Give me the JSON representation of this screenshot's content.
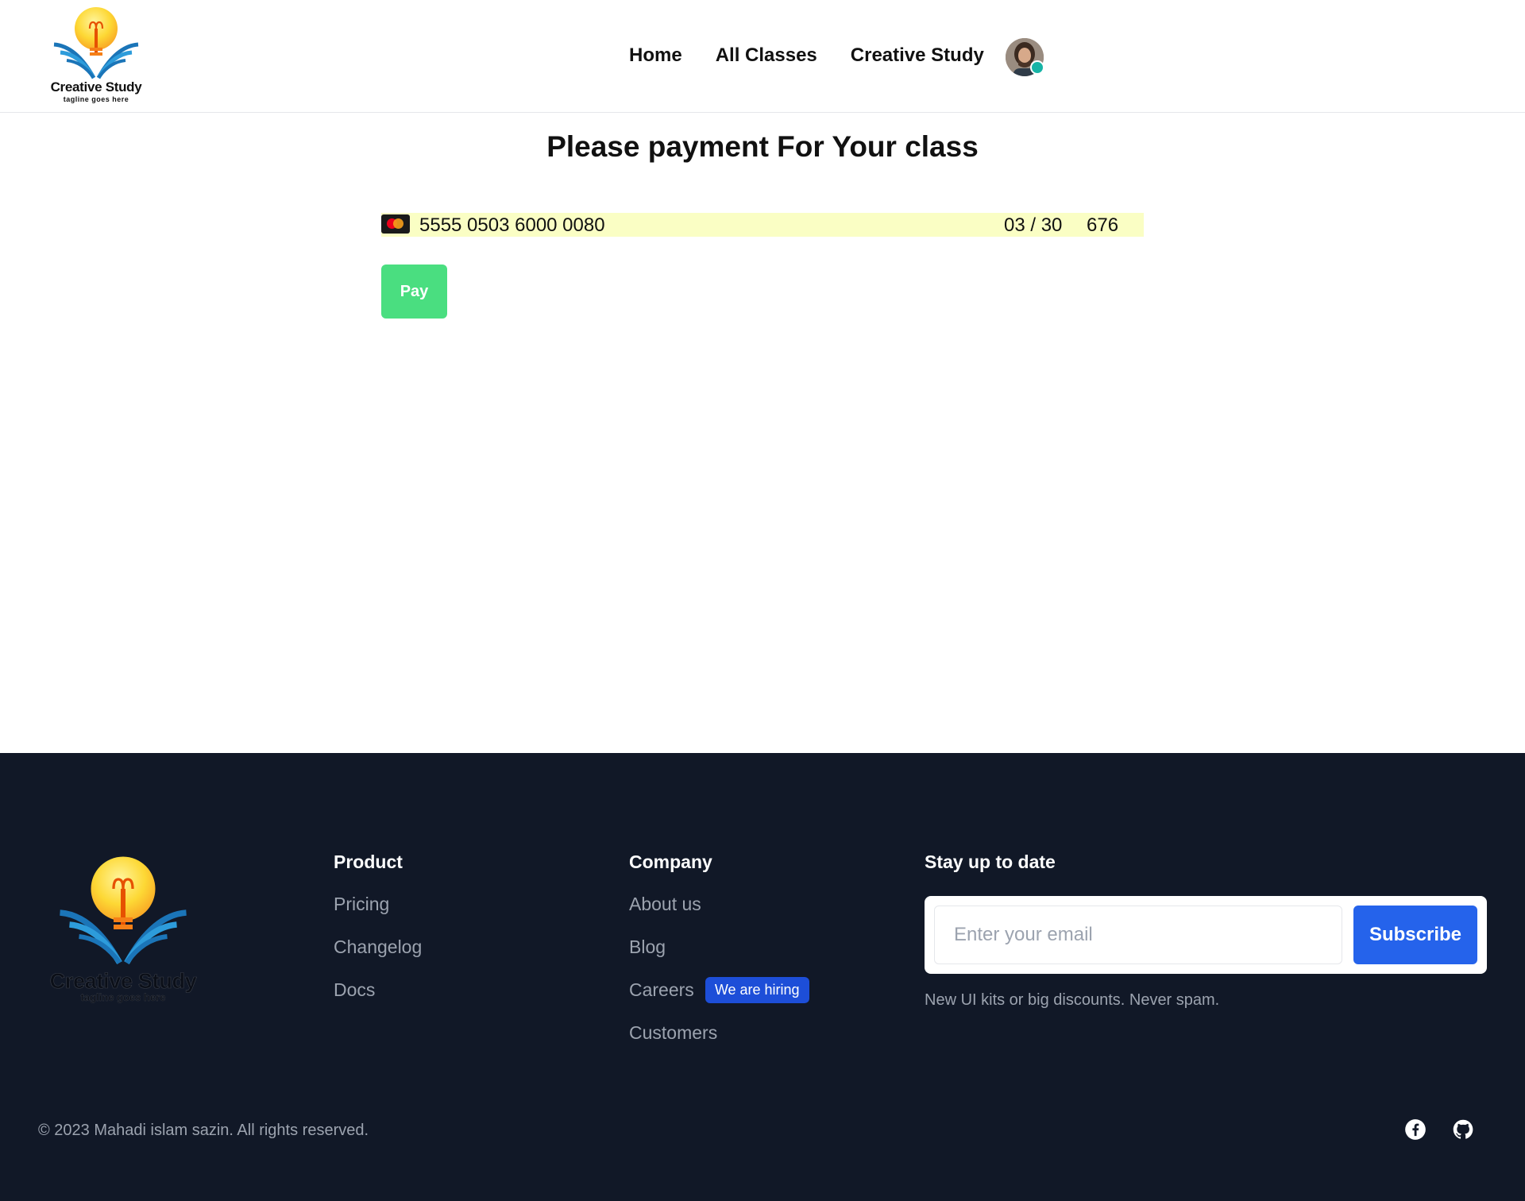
{
  "header": {
    "brand": "Creative Study",
    "tagline": "tagline goes here",
    "nav": [
      {
        "label": "Home"
      },
      {
        "label": "All Classes"
      },
      {
        "label": "Creative Study"
      }
    ]
  },
  "payment": {
    "title": "Please payment For Your class",
    "card_brand_icon": "mastercard-icon",
    "card_number": "5555 0503 6000 0080",
    "expiry": "03 / 30",
    "cvc": "676",
    "pay_label": "Pay"
  },
  "footer": {
    "brand": "Creative Study",
    "tagline": "tagline goes here",
    "product": {
      "heading": "Product",
      "links": [
        "Pricing",
        "Changelog",
        "Docs"
      ]
    },
    "company": {
      "heading": "Company",
      "links": [
        "About us",
        "Blog",
        "Careers",
        "Customers"
      ],
      "careers_badge": "We are hiring"
    },
    "subscribe": {
      "heading": "Stay up to date",
      "placeholder": "Enter your email",
      "button": "Subscribe",
      "note": "New UI kits or big discounts. Never spam."
    },
    "copyright": "© 2023 Mahadi islam sazin. All rights reserved.",
    "social_icons": [
      "facebook-icon",
      "github-icon"
    ]
  },
  "colors": {
    "pay_button": "#4ade80",
    "card_field_bg": "#fafec4",
    "footer_bg": "#111827",
    "subscribe_button": "#2563eb",
    "hiring_badge": "#1d4ed8",
    "online_status": "#17b4a6"
  }
}
